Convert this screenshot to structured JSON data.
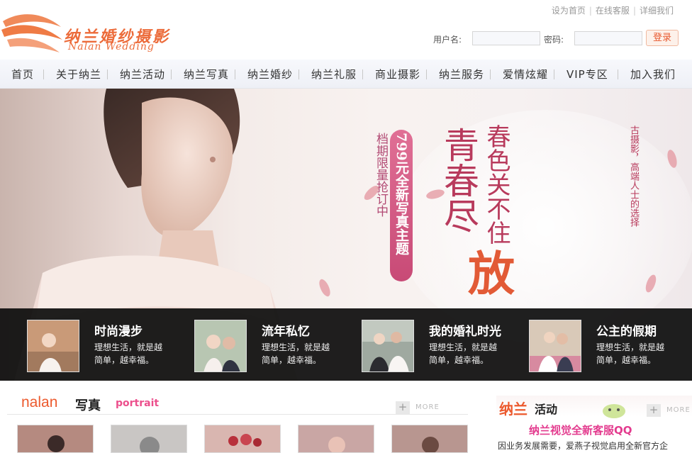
{
  "header": {
    "logo": {
      "brand": "纳兰婚纱摄影",
      "brand_en": "Nalan Wedding"
    },
    "toplinks": [
      "设为首页",
      "在线客服",
      "详细我们"
    ],
    "login": {
      "username_label": "用户名:",
      "password_label": "密码:",
      "submit": "登录"
    }
  },
  "nav": {
    "items": [
      "首页",
      "关于纳兰",
      "纳兰活动",
      "纳兰写真",
      "纳兰婚纱",
      "纳兰礼服",
      "商业摄影",
      "纳兰服务",
      "爱情炫耀",
      "VIP专区",
      "加入我们"
    ]
  },
  "banner": {
    "promo_line1": "档期限量抢订中",
    "promo_pill": "799元全新写真主题",
    "headline_col1": "春色关不住",
    "headline_col2": "青春尽",
    "headline_big": "放",
    "side_text": "古摄影，高端人士的选择"
  },
  "features": [
    {
      "title": "时尚漫步",
      "desc": "理想生活，就是越简单，越幸福。"
    },
    {
      "title": "流年私忆",
      "desc": "理想生活，就是越简单，越幸福。"
    },
    {
      "title": "我的婚礼时光",
      "desc": "理想生活，就是越简单，越幸福。"
    },
    {
      "title": "公主的假期",
      "desc": "理想生活，就是越简单，越幸福。"
    }
  ],
  "portrait_section": {
    "brand": "nalan",
    "title": "写真",
    "title_en": "portrait",
    "more": "MORE"
  },
  "activity_section": {
    "brand": "纳兰",
    "title": "活动",
    "more": "MORE",
    "news_title": "纳兰视觉全新客服QQ",
    "news_sub": "因业务发展需要，爱燕子视觉启用全新官方企"
  },
  "colors": {
    "accent": "#ec5a2e",
    "pink": "#e33b8e",
    "strip": "#0c0c0c"
  }
}
